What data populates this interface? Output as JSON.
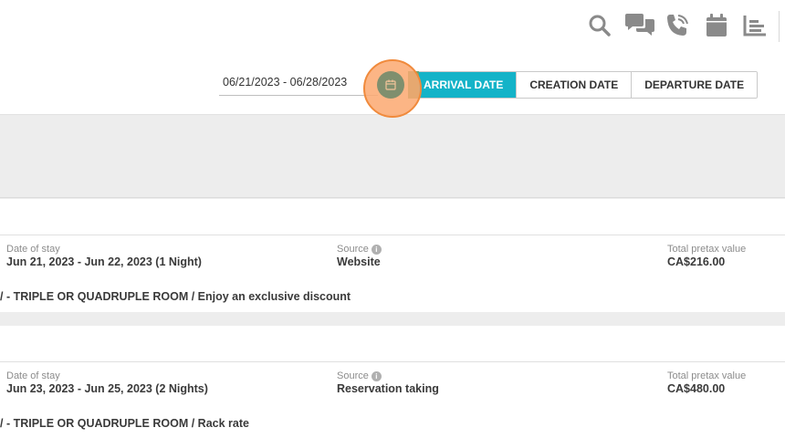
{
  "header": {
    "icons": [
      "search-icon",
      "chat-icon",
      "phone-icon",
      "calendar-icon",
      "report-icon"
    ]
  },
  "filter": {
    "date_range": "06/21/2023 - 06/28/2023",
    "modes": [
      "ARRIVAL DATE",
      "CREATION DATE",
      "DEPARTURE DATE"
    ],
    "active_mode": "ARRIVAL DATE"
  },
  "reservations": [
    {
      "stay_label": "Date of stay",
      "stay_value": "Jun 21, 2023 - Jun 22, 2023 (1 Night)",
      "source_label": "Source",
      "source_value": "Website",
      "total_label": "Total pretax value",
      "total_value": "CA$216.00",
      "room": "/ - TRIPLE OR QUADRUPLE ROOM / Enjoy an exclusive discount"
    },
    {
      "stay_label": "Date of stay",
      "stay_value": "Jun 23, 2023 - Jun 25, 2023 (2 Nights)",
      "source_label": "Source",
      "source_value": "Reservation taking",
      "total_label": "Total pretax value",
      "total_value": "CA$480.00",
      "room": "/ - TRIPLE OR QUADRUPLE ROOM / Rack rate"
    }
  ],
  "colors": {
    "accent": "#14b3c8",
    "highlight": "#f08a3c",
    "calendar_button": "#7f8f6e"
  }
}
